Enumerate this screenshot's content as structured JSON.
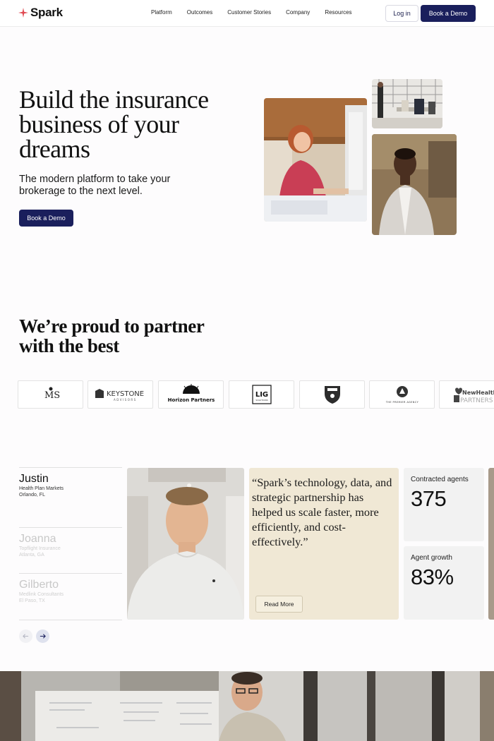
{
  "brand": {
    "name": "Spark",
    "accent": "#e04a52",
    "navy": "#1a1f5c"
  },
  "nav": {
    "links": [
      "Platform",
      "Outcomes",
      "Customer Stories",
      "Company",
      "Resources"
    ],
    "login_label": "Log in",
    "demo_label": "Book a Demo"
  },
  "hero": {
    "title": "Build the insurance business of your dreams",
    "subtitle": "The modern platform to take your brokerage to the next level.",
    "cta_label": "Book a Demo"
  },
  "partners": {
    "title": "We’re proud to partner with the best",
    "logos": [
      {
        "name": "MS logo",
        "text": "MS"
      },
      {
        "name": "Keystone Advisors logo",
        "text": "KEYSTONE",
        "sub": "ADVISORS"
      },
      {
        "name": "Horizon Partners logo",
        "text": "Horizon Partners"
      },
      {
        "name": "LIG Solutions logo",
        "text": "LIG",
        "sub": "SOLUTIONS"
      },
      {
        "name": "Shield logo",
        "text": ""
      },
      {
        "name": "The Premier Agency logo",
        "text": "THE PREMIER AGENCY"
      },
      {
        "name": "New Health Partners logo",
        "text": "NewHealth",
        "sub": "PARTNERS"
      }
    ]
  },
  "testimonial": {
    "people": [
      {
        "name": "Justin",
        "company": "Health Plan Markets",
        "location": "Orlando, FL"
      },
      {
        "name": "Joanna",
        "company": "Topflight Insurance",
        "location": "Atlanta, GA"
      },
      {
        "name": "Gilberto",
        "company": "Medlink Consultants",
        "location": "El Paso, TX"
      }
    ],
    "quote": "“Spark’s technology, data, and strategic partnership has helped us scale faster, more efficiently, and cost-effectively.”",
    "read_more_label": "Read More",
    "stats": [
      {
        "label": "Contracted agents",
        "value": "375"
      },
      {
        "label": "Agent growth",
        "value": "83%"
      }
    ]
  }
}
